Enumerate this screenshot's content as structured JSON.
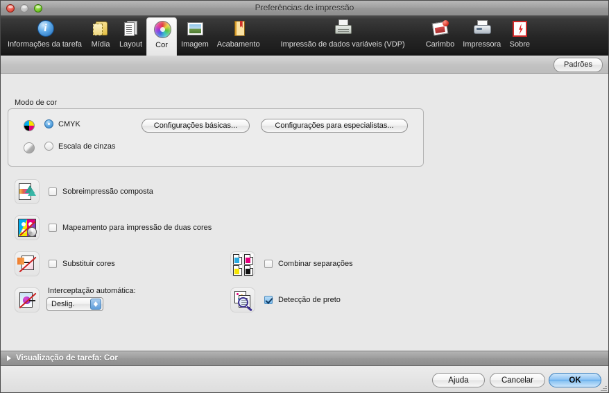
{
  "window": {
    "title": "Preferências de impressão",
    "controls": {
      "close": "close",
      "minimize": "minimize",
      "zoom": "zoom"
    }
  },
  "toolbar": {
    "items": [
      {
        "label": "Informações da tarefa",
        "icon": "info-icon",
        "selected": false
      },
      {
        "label": "Mídia",
        "icon": "media-icon",
        "selected": false
      },
      {
        "label": "Layout",
        "icon": "layout-icon",
        "selected": false
      },
      {
        "label": "Cor",
        "icon": "color-wheel-icon",
        "selected": true
      },
      {
        "label": "Imagem",
        "icon": "image-icon",
        "selected": false
      },
      {
        "label": "Acabamento",
        "icon": "finishing-icon",
        "selected": false
      },
      {
        "label": "Impressão de dados variáveis (VDP)",
        "icon": "vdp-printer-icon",
        "selected": false
      },
      {
        "label": "Carimbo",
        "icon": "stamp-icon",
        "selected": false
      },
      {
        "label": "Impressora",
        "icon": "printer-icon",
        "selected": false
      },
      {
        "label": "Sobre",
        "icon": "about-icon",
        "selected": false
      }
    ]
  },
  "subbar": {
    "defaults_label": "Padrões"
  },
  "main": {
    "color_mode": {
      "group_label": "Modo de cor",
      "options": [
        {
          "label": "CMYK",
          "selected": true,
          "swatch": "cmyk-wheel-icon"
        },
        {
          "label": "Escala de cinzas",
          "selected": false,
          "swatch": "grayscale-sphere-icon"
        }
      ],
      "buttons": [
        {
          "label": "Configurações básicas..."
        },
        {
          "label": "Configurações para especialistas..."
        }
      ]
    },
    "options_left": [
      {
        "label": "Sobreimpressão composta",
        "checked": false,
        "icon": "composite-overprint-icon"
      },
      {
        "label": "Mapeamento para impressão de duas cores",
        "checked": false,
        "icon": "two-color-map-icon"
      },
      {
        "label": "Substituir cores",
        "checked": false,
        "icon": "substitute-colors-icon"
      }
    ],
    "options_right": [
      {
        "label": "Combinar separações",
        "checked": false,
        "icon": "combine-separations-icon"
      },
      {
        "label": "Detecção de preto",
        "checked": true,
        "icon": "black-detection-icon"
      }
    ],
    "auto_trapping": {
      "label": "Interceptação automática:",
      "value": "Deslig.",
      "icon": "auto-trapping-icon"
    }
  },
  "disclosure": {
    "label": "Visualização de tarefa: Cor",
    "expanded": false
  },
  "footer": {
    "buttons": [
      {
        "label": "Ajuda",
        "default": false
      },
      {
        "label": "Cancelar",
        "default": false
      },
      {
        "label": "OK",
        "default": true
      }
    ]
  },
  "colors": {
    "accent_blue": "#56a3e9",
    "toolbar_dark": "#272727",
    "content_bg": "#e8e8e8",
    "disclosure_bar": "#989898",
    "checked_blue": "#7dbcee"
  }
}
